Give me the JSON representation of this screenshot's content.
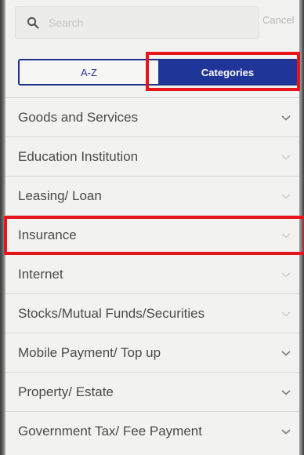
{
  "search": {
    "placeholder": "Search",
    "cancel_label": "Cancel"
  },
  "segment": {
    "tabs": [
      {
        "label": "A-Z",
        "selected": false
      },
      {
        "label": "Categories",
        "selected": true
      }
    ]
  },
  "categories": {
    "items": [
      {
        "label": "Goods and Services",
        "icon": "chevron-down-icon"
      },
      {
        "label": "Education Institution",
        "icon": "chevron-down-icon"
      },
      {
        "label": "Leasing/ Loan",
        "icon": "chevron-down-icon"
      },
      {
        "label": "Insurance",
        "icon": "chevron-down-icon"
      },
      {
        "label": "Internet",
        "icon": "chevron-down-icon"
      },
      {
        "label": "Stocks/Mutual Funds/Securities",
        "icon": "chevron-down-icon"
      },
      {
        "label": "Mobile Payment/ Top up",
        "icon": "chevron-down-icon"
      },
      {
        "label": "Property/ Estate",
        "icon": "chevron-down-icon"
      },
      {
        "label": "Government Tax/ Fee Payment",
        "icon": "chevron-down-icon"
      }
    ]
  },
  "colors": {
    "accent": "#1f3598",
    "highlight": "#e8141c",
    "background": "#f2f2f0"
  }
}
